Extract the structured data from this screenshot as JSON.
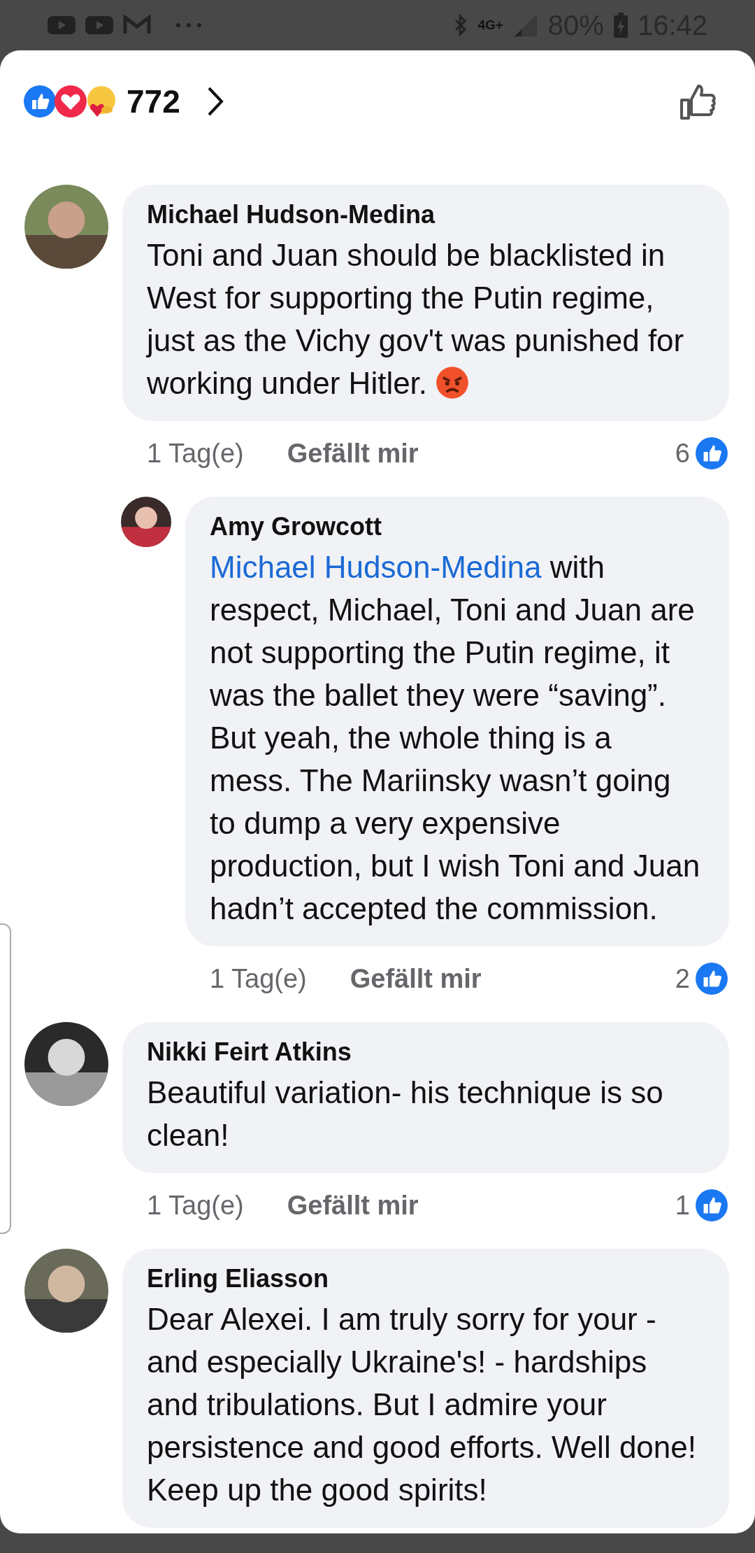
{
  "status_bar": {
    "network": "4G+",
    "battery": "80%",
    "time": "16:42"
  },
  "header": {
    "reaction_count": "772"
  },
  "comments": [
    {
      "author": "Michael Hudson-Medina",
      "reply": false,
      "text": "Toni and Juan should be blacklisted in West for supporting the Putin regime, just as the Vichy gov't was punished for working under Hitler.",
      "end_icon": {
        "kind": "angry"
      },
      "age": "1 Tag(e)",
      "like_label": "Gefällt mir",
      "likes": "6"
    },
    {
      "author": "Amy Growcott",
      "reply": true,
      "mention": "Michael Hudson-Medina",
      "text": "with respect, Michael, Toni and Juan are not supporting the Putin regime, it was the ballet they were “saving”. But yeah, the whole thing is a mess. The Mariinsky wasn’t going to dump a very expensive production, but I wish Toni and Juan hadn’t accepted the commission.",
      "age": "1 Tag(e)",
      "like_label": "Gefällt mir",
      "likes": "2"
    },
    {
      "author": "Nikki Feirt Atkins",
      "reply": false,
      "text": "Beautiful variation- his technique is so clean!",
      "age": "1 Tag(e)",
      "like_label": "Gefällt mir",
      "likes": "1"
    },
    {
      "author": "Erling Eliasson",
      "reply": false,
      "text": "Dear Alexei. I am truly sorry for your - and especially Ukraine's! - hardships and tribulations. But I admire your persistence and good efforts. Well done! Keep up the good spirits!"
    }
  ]
}
